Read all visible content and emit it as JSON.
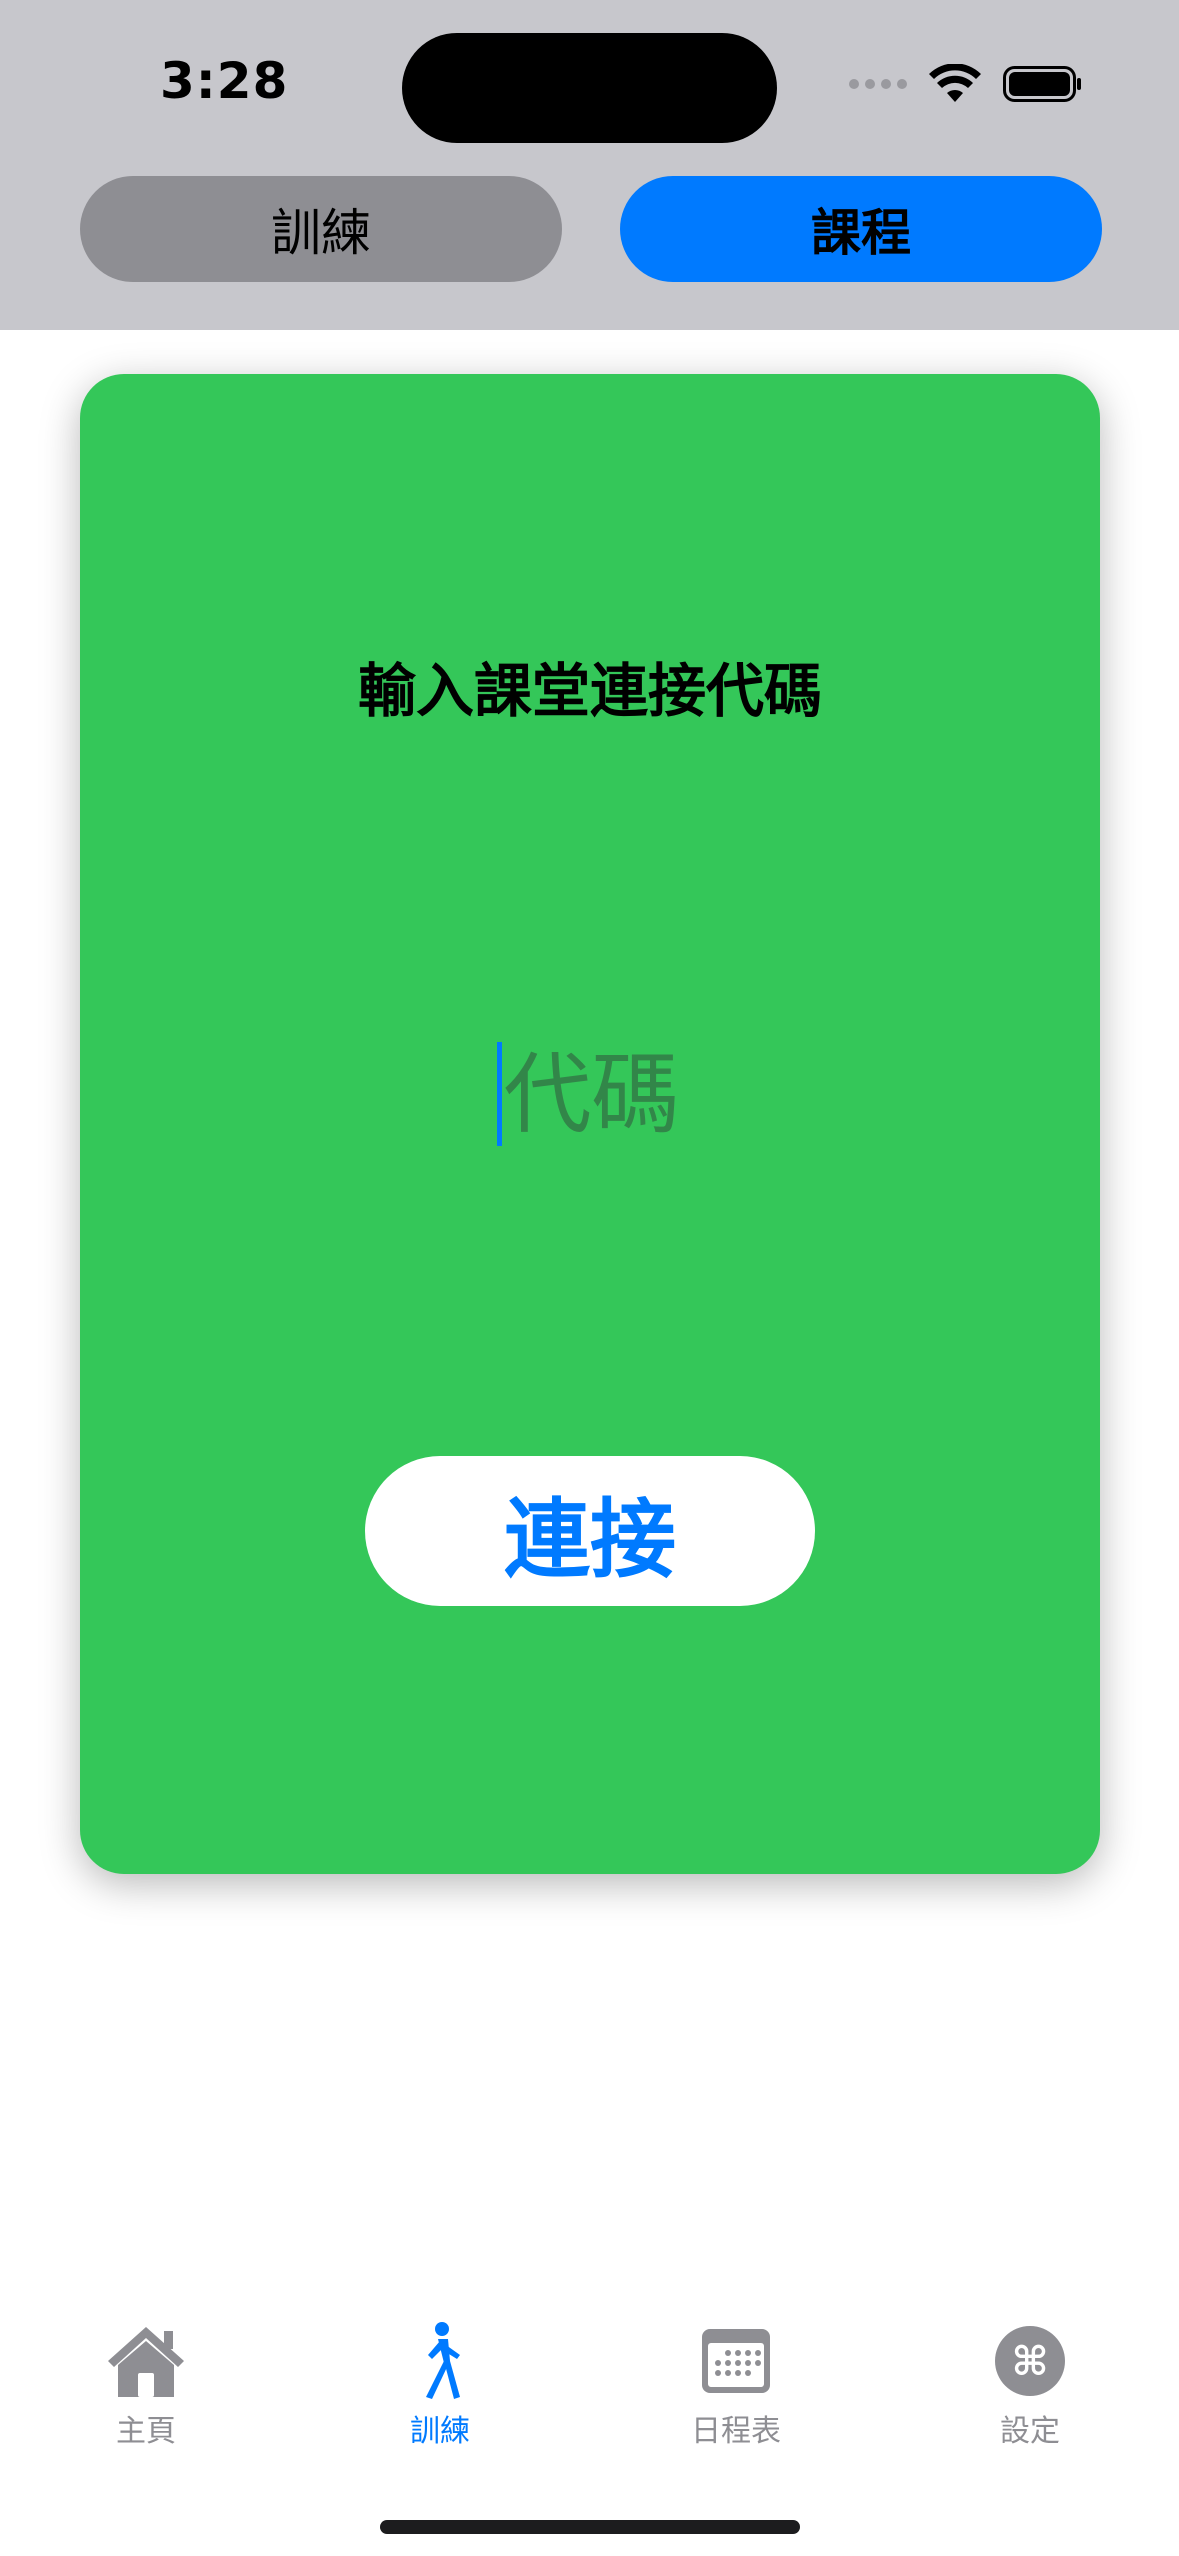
{
  "status_bar": {
    "time": "3:28",
    "icons": [
      "cellular-dots-icon",
      "wifi-icon",
      "battery-icon"
    ]
  },
  "segmented_control": {
    "options": [
      {
        "label": "訓練",
        "selected": false
      },
      {
        "label": "課程",
        "selected": true
      }
    ],
    "selected_color": "#007aff",
    "unselected_color": "#8e8e93"
  },
  "card": {
    "background": "#34c759",
    "title": "輸入課堂連接代碼",
    "code_input": {
      "placeholder": "代碼",
      "value": ""
    },
    "connect_button_label": "連接"
  },
  "tab_bar": {
    "items": [
      {
        "label": "主頁",
        "icon": "house-icon",
        "active": false
      },
      {
        "label": "訓練",
        "icon": "walking-figure-icon",
        "active": true
      },
      {
        "label": "日程表",
        "icon": "calendar-icon",
        "active": false
      },
      {
        "label": "設定",
        "icon": "command-icon",
        "active": false
      }
    ],
    "active_color": "#007aff",
    "inactive_color": "#8e8e93"
  }
}
